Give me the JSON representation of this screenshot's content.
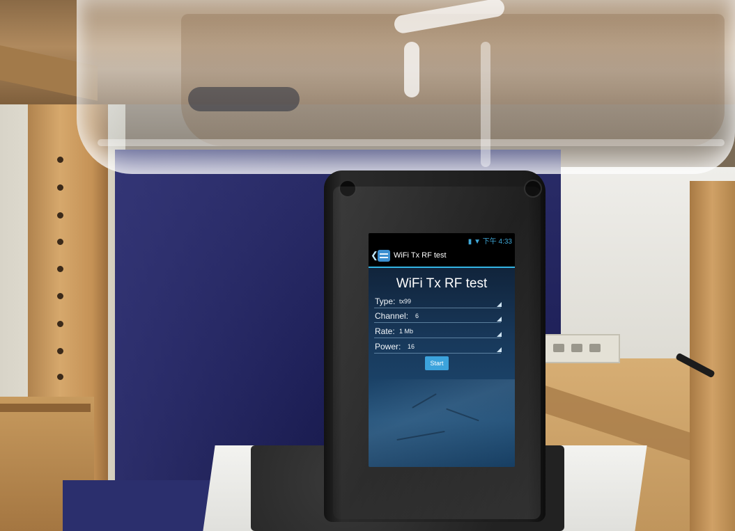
{
  "screen": {
    "status_time": "下午 4:33",
    "actionbar_title": "WiFi Tx RF test",
    "main_title": "WiFi Tx RF test",
    "fields": [
      {
        "label": "Type:",
        "value": "tx99"
      },
      {
        "label": "Channel:",
        "value": "6"
      },
      {
        "label": "Rate:",
        "value": "1 Mb"
      },
      {
        "label": "Power:",
        "value": "16"
      }
    ],
    "start_label": "Start"
  },
  "colors": {
    "accent": "#33b5e5",
    "button": "#3ca3dc",
    "backdrop": "#1e2058"
  },
  "icons": [
    "back-chevron-icon",
    "app-icon",
    "battery-icon",
    "wifi-icon",
    "spinner-arrow-icon"
  ]
}
